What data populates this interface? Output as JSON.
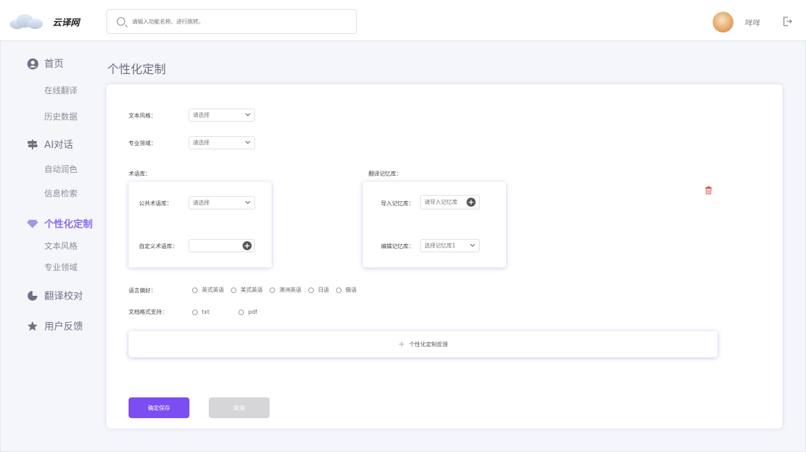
{
  "header": {
    "brand": "云译网",
    "search_placeholder": "请输入功能名称、进行跳转。",
    "username": "咩咩"
  },
  "sidebar": {
    "groups": [
      {
        "label": "首页",
        "icon": "user-circle-icon",
        "items": [
          "在线翻译",
          "历史数据"
        ]
      },
      {
        "label": "AI对话",
        "icon": "signpost-icon",
        "items": [
          "自动润色",
          "信息检索"
        ]
      },
      {
        "label": "个性化定制",
        "icon": "diamond-icon",
        "active": true,
        "items": [
          "文本风格",
          "专业领域"
        ]
      },
      {
        "label": "翻译校对",
        "icon": "pie-chart-icon",
        "items": []
      },
      {
        "label": "用户反馈",
        "icon": "star-icon",
        "items": []
      }
    ]
  },
  "main": {
    "title": "个性化定制",
    "text_style": {
      "label": "文本风格：",
      "value": "请选择"
    },
    "domain": {
      "label": "专业领域：",
      "value": "请选择"
    },
    "terminology": {
      "label": "术语库：",
      "public_label": "公共术语库：",
      "public_value": "请选择",
      "custom_label": "自定义术语库："
    },
    "memory": {
      "label": "翻译记忆库：",
      "import_label": "导入记忆库：",
      "import_value": "请导入记忆库",
      "edit_label": "编辑记忆库：",
      "edit_value": "选择记忆库1"
    },
    "language_pref": {
      "label": "语言偏好：",
      "options": [
        "英式英语",
        "美式英语",
        "澳洲英语",
        "日语",
        "俄语"
      ]
    },
    "doc_format": {
      "label": "文档格式支持：",
      "options": [
        "txt",
        "pdf"
      ]
    },
    "add_feedback": "个性化定制反馈",
    "save_label": "确定保存",
    "cancel_label": "取消"
  },
  "colors": {
    "accent": "#7b4df2",
    "active_nav": "#8b6cf0",
    "delete": "#e04040"
  }
}
